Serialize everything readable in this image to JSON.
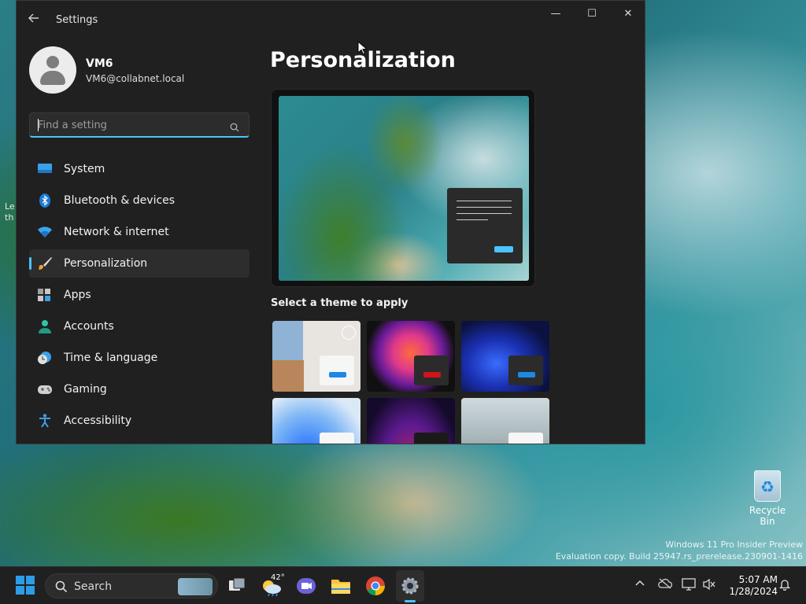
{
  "desktop": {
    "recycle_bin_label": "Recycle Bin",
    "watermark_line1": "Windows 11 Pro Insider Preview",
    "watermark_line2": "Evaluation copy. Build 25947.rs_prerelease.230901-1416",
    "left_text_line1": "Le",
    "left_text_line2": "th"
  },
  "window": {
    "title": "Settings",
    "controls": {
      "minimize": "—",
      "maximize": "☐",
      "close": "✕"
    }
  },
  "profile": {
    "name": "VM6",
    "email": "VM6@collabnet.local"
  },
  "search": {
    "placeholder": "Find a setting"
  },
  "nav": {
    "items": [
      {
        "label": "System",
        "icon": "system-icon"
      },
      {
        "label": "Bluetooth & devices",
        "icon": "bluetooth-icon"
      },
      {
        "label": "Network & internet",
        "icon": "wifi-icon"
      },
      {
        "label": "Personalization",
        "icon": "brush-icon",
        "active": true
      },
      {
        "label": "Apps",
        "icon": "apps-icon"
      },
      {
        "label": "Accounts",
        "icon": "accounts-icon"
      },
      {
        "label": "Time & language",
        "icon": "clock-globe-icon"
      },
      {
        "label": "Gaming",
        "icon": "gamepad-icon"
      },
      {
        "label": "Accessibility",
        "icon": "accessibility-icon"
      }
    ]
  },
  "page": {
    "title": "Personalization",
    "theme_section_label": "Select a theme to apply"
  },
  "themes": {
    "items": [
      {
        "name": "spotlight-theme",
        "accent": "#1e88e5"
      },
      {
        "name": "glow-theme",
        "accent": "#d0141c"
      },
      {
        "name": "dark-bloom-theme",
        "accent": "#1e88e5"
      },
      {
        "name": "light-bloom-theme",
        "accent": "#1e88e5"
      },
      {
        "name": "captured-motion-theme",
        "accent": "#1a1a1a"
      },
      {
        "name": "flow-theme",
        "accent": "#ffffff"
      }
    ]
  },
  "taskbar": {
    "search_label": "Search",
    "weather_temp": "42°",
    "clock_time": "5:07 AM",
    "clock_date": "1/28/2024"
  },
  "colors": {
    "accent": "#4cc2ff",
    "window_bg": "#202020"
  }
}
